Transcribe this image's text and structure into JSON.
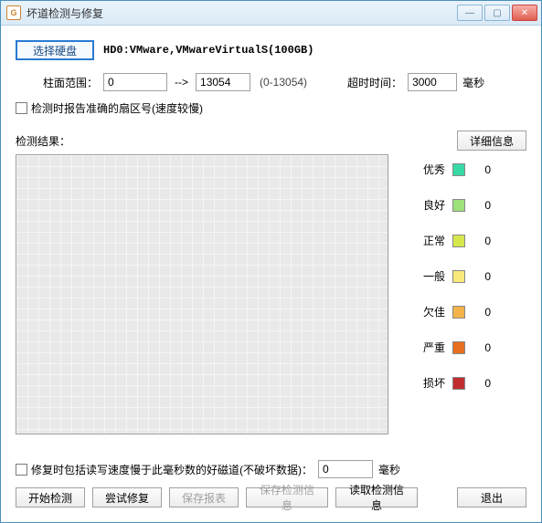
{
  "window": {
    "title": "坏道检测与修复"
  },
  "topbar": {
    "select_disk_btn": "选择硬盘",
    "disk_label": "HD0:VMware,VMwareVirtualS(100GB)"
  },
  "cylinder": {
    "label": "柱面范围：",
    "start": "0",
    "arrow": "-->",
    "end": "13054",
    "hint": "(0-13054)",
    "timeout_label": "超时时间：",
    "timeout": "3000",
    "timeout_unit": "毫秒"
  },
  "accurate_chk_label": "检测时报告准确的扇区号(速度较慢)",
  "results_label": "检测结果：",
  "detail_btn": "详细信息",
  "legend": [
    {
      "label": "优秀",
      "color": "#39d9a7",
      "count": "0"
    },
    {
      "label": "良好",
      "color": "#9de07c",
      "count": "0"
    },
    {
      "label": "正常",
      "color": "#d7e84e",
      "count": "0"
    },
    {
      "label": "一般",
      "color": "#f7e97c",
      "count": "0"
    },
    {
      "label": "欠佳",
      "color": "#f2b34a",
      "count": "0"
    },
    {
      "label": "严重",
      "color": "#e86f1f",
      "count": "0"
    },
    {
      "label": "损坏",
      "color": "#c02d30",
      "count": "0"
    }
  ],
  "repair_chk": {
    "label_before": "修复时包括读写速度慢于此毫秒数的好磁道(不破坏数据)：",
    "value": "0",
    "unit": "毫秒"
  },
  "buttons": {
    "start": "开始检测",
    "try_repair": "尝试修复",
    "save_report": "保存报表",
    "save_info": "保存检测信息",
    "read_info": "读取检测信息",
    "exit": "退出"
  }
}
